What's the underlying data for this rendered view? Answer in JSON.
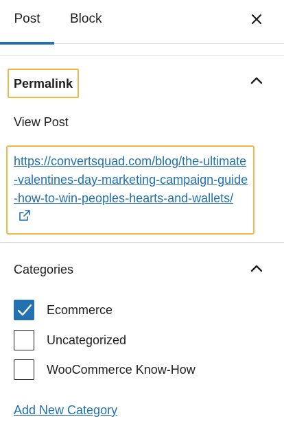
{
  "tabs": {
    "post": "Post",
    "block": "Block"
  },
  "permalink": {
    "title": "Permalink",
    "view_post": "View Post",
    "url": "https://convertsquad.com/blog/the-ultimate-valentines-day-marketing-campaign-guide-how-to-win-peoples-hearts-and-wallets/"
  },
  "categories": {
    "title": "Categories",
    "items": [
      {
        "label": "Ecommerce",
        "checked": true
      },
      {
        "label": "Uncategorized",
        "checked": false
      },
      {
        "label": "WooCommerce Know-How",
        "checked": false
      }
    ],
    "add_new": "Add New Category"
  },
  "colors": {
    "accent": "#2271b1",
    "highlight": "#f0b849"
  },
  "icons": {
    "close": "close-icon",
    "chevron": "chevron-up-icon",
    "external": "external-link-icon",
    "check": "checkmark-icon"
  }
}
